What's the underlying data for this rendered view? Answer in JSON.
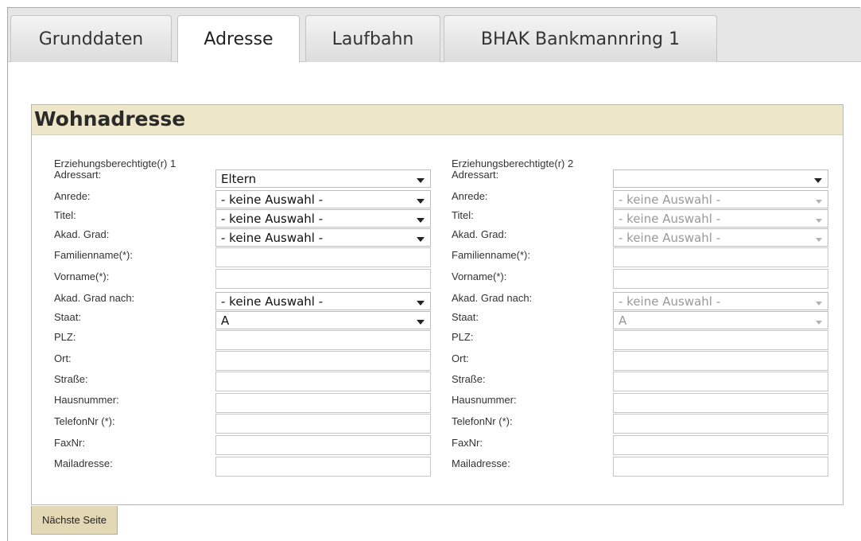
{
  "tabs": [
    {
      "label": "Grunddaten"
    },
    {
      "label": "Adresse"
    },
    {
      "label": "Laufbahn"
    },
    {
      "label": "BHAK Bankmannring 1"
    }
  ],
  "section": {
    "title": "Wohnadresse"
  },
  "guardian1": {
    "heading": "Erziehungsberechtigte(r) 1",
    "fields": [
      {
        "label": "Adressart:",
        "value": "Eltern"
      },
      {
        "label": "Anrede:",
        "value": "- keine Auswahl -"
      },
      {
        "label": "Titel:",
        "value": "- keine Auswahl -"
      },
      {
        "label": "Akad. Grad:",
        "value": "- keine Auswahl -"
      },
      {
        "label": "Familienname(*):",
        "value": ""
      },
      {
        "label": "Vorname(*):",
        "value": ""
      },
      {
        "label": "Akad. Grad nach:",
        "value": "- keine Auswahl -"
      },
      {
        "label": "Staat:",
        "value": "A"
      },
      {
        "label": "PLZ:",
        "value": ""
      },
      {
        "label": "Ort:",
        "value": ""
      },
      {
        "label": "Straße:",
        "value": ""
      },
      {
        "label": "Hausnummer:",
        "value": ""
      },
      {
        "label": "TelefonNr (*):",
        "value": ""
      },
      {
        "label": "FaxNr:",
        "value": ""
      },
      {
        "label": "Mailadresse:",
        "value": ""
      }
    ]
  },
  "guardian2": {
    "heading": "Erziehungsberechtigte(r) 2",
    "fields": [
      {
        "label": "Adressart:",
        "value": ""
      },
      {
        "label": "Anrede:",
        "value": "- keine Auswahl -"
      },
      {
        "label": "Titel:",
        "value": "- keine Auswahl -"
      },
      {
        "label": "Akad. Grad:",
        "value": "- keine Auswahl -"
      },
      {
        "label": "Familienname(*):",
        "value": ""
      },
      {
        "label": "Vorname(*):",
        "value": ""
      },
      {
        "label": "Akad. Grad nach:",
        "value": "- keine Auswahl -"
      },
      {
        "label": "Staat:",
        "value": "A"
      },
      {
        "label": "PLZ:",
        "value": ""
      },
      {
        "label": "Ort:",
        "value": ""
      },
      {
        "label": "Straße:",
        "value": ""
      },
      {
        "label": "Hausnummer:",
        "value": ""
      },
      {
        "label": "TelefonNr (*):",
        "value": ""
      },
      {
        "label": "FaxNr:",
        "value": ""
      },
      {
        "label": "Mailadresse:",
        "value": ""
      }
    ]
  },
  "buttons": {
    "next": "Nächste Seite"
  }
}
